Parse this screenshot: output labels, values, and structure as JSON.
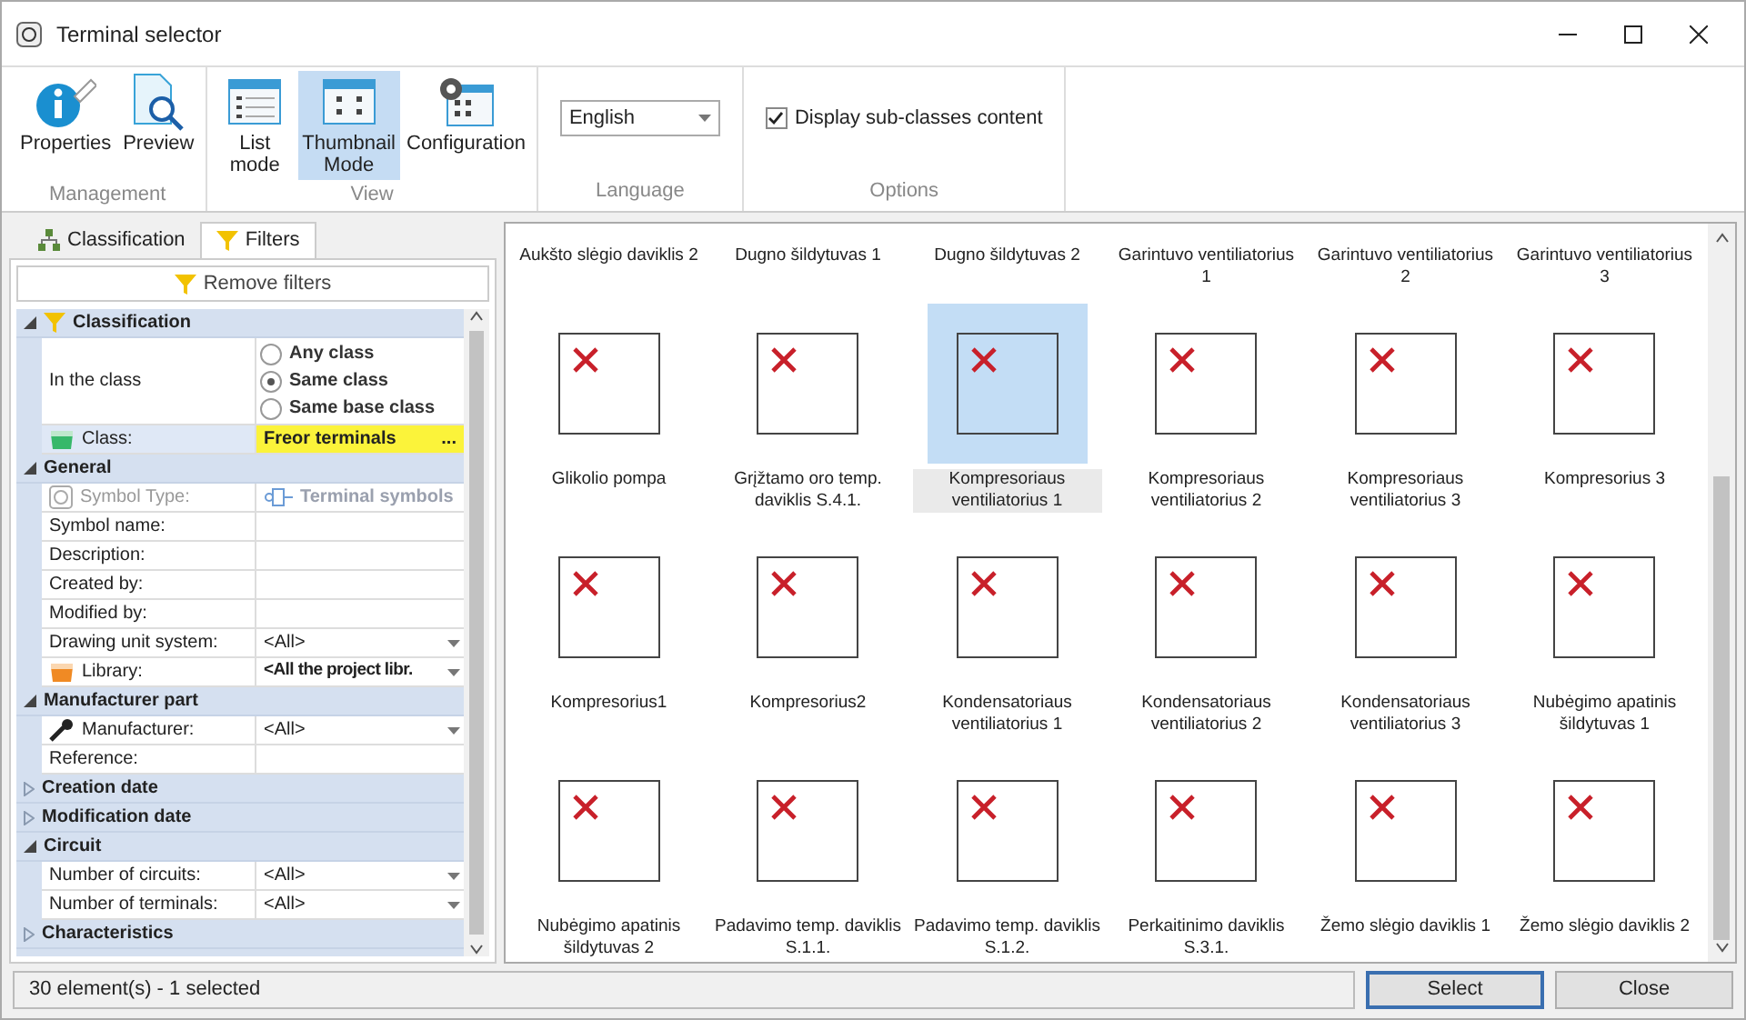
{
  "window": {
    "title": "Terminal selector"
  },
  "ribbon": {
    "groups": [
      {
        "label": "Management",
        "buttons": [
          {
            "kind": "properties",
            "label": "Properties",
            "selected": false
          },
          {
            "kind": "preview",
            "label": "Preview",
            "selected": false
          }
        ]
      },
      {
        "label": "View",
        "buttons": [
          {
            "kind": "list",
            "label": "List mode",
            "selected": false
          },
          {
            "kind": "thumbnail",
            "label": "Thumbnail Mode",
            "selected": true
          },
          {
            "kind": "configuration",
            "label": "Configuration",
            "selected": false
          }
        ]
      },
      {
        "label": "Language",
        "kind": "dropdown",
        "value": "English"
      },
      {
        "label": "Options",
        "kind": "checkbox",
        "text": "Display sub-classes content",
        "checked": true
      }
    ]
  },
  "left_tabs": [
    {
      "kind": "tree",
      "label": "Classification",
      "selected": false
    },
    {
      "kind": "filter",
      "label": "Filters",
      "selected": true
    }
  ],
  "remove_filters": "Remove filters",
  "property_grid": [
    {
      "category": "Classification",
      "expanded": true,
      "rows": [
        {
          "kind": "radio",
          "label": "In the class",
          "options": [
            {
              "label": "Any class",
              "selected": false
            },
            {
              "label": "Same class",
              "selected": true
            },
            {
              "label": "Same base class",
              "selected": false
            }
          ]
        },
        {
          "kind": "highlight",
          "label": "Class:",
          "value": "Freor terminals",
          "button": "..."
        }
      ]
    },
    {
      "category": "General",
      "expanded": true,
      "rows": [
        {
          "kind": "disabled",
          "label": "Symbol Type:",
          "value": "Terminal symbols"
        },
        {
          "kind": "text",
          "label": "Symbol name:"
        },
        {
          "kind": "text",
          "label": "Description:"
        },
        {
          "kind": "text",
          "label": "Created by:"
        },
        {
          "kind": "text",
          "label": "Modified by:"
        },
        {
          "kind": "dropdown",
          "label": "Drawing unit system:",
          "value": "<All>"
        },
        {
          "kind": "dropdown",
          "label": "Library:",
          "value": "<All the project libr.",
          "bold": true
        }
      ]
    },
    {
      "category": "Manufacturer part",
      "expanded": true,
      "rows": [
        {
          "kind": "dropdown",
          "label": "Manufacturer:",
          "value": "<All>"
        },
        {
          "kind": "text",
          "label": "Reference:"
        }
      ]
    },
    {
      "category": "Creation date",
      "expanded": false
    },
    {
      "category": "Modification date",
      "expanded": false
    },
    {
      "category": "Circuit",
      "expanded": true,
      "rows": [
        {
          "kind": "dropdown",
          "label": "Number of circuits:",
          "value": "<All>"
        },
        {
          "kind": "dropdown",
          "label": "Number of terminals:",
          "value": "<All>"
        }
      ]
    },
    {
      "category": "Characteristics",
      "expanded": false
    }
  ],
  "thumbnails": {
    "top_labels": [
      "Aukšto slėgio daviklis 2",
      "Dugno šildytuvas 1",
      "Dugno šildytuvas 2",
      "Garintuvo ventiliatorius 1",
      "Garintuvo ventiliatorius 2",
      "Garintuvo ventiliatorius 3"
    ],
    "items": [
      {
        "label": "Glikolio pompa",
        "selected": false
      },
      {
        "label": "Grįžtamo oro temp. daviklis S.4.1.",
        "selected": false
      },
      {
        "label": "Kompresoriaus ventiliatorius 1",
        "selected": true
      },
      {
        "label": "Kompresoriaus ventiliatorius 2",
        "selected": false
      },
      {
        "label": "Kompresoriaus ventiliatorius 3",
        "selected": false
      },
      {
        "label": "Kompresorius 3",
        "selected": false
      },
      {
        "label": "Kompresorius1",
        "selected": false
      },
      {
        "label": "Kompresorius2",
        "selected": false
      },
      {
        "label": "Kondensatoriaus ventiliatorius 1",
        "selected": false
      },
      {
        "label": "Kondensatoriaus ventiliatorius 2",
        "selected": false
      },
      {
        "label": "Kondensatoriaus ventiliatorius 3",
        "selected": false
      },
      {
        "label": "Nubėgimo apatinis šildytuvas 1",
        "selected": false
      },
      {
        "label": "Nubėgimo apatinis šildytuvas 2",
        "selected": false
      },
      {
        "label": "Padavimo temp. daviklis S.1.1.",
        "selected": false
      },
      {
        "label": "Padavimo temp. daviklis S.1.2.",
        "selected": false
      },
      {
        "label": "Perkaitinimo daviklis S.3.1.",
        "selected": false
      },
      {
        "label": "Žemo slėgio daviklis 1",
        "selected": false
      },
      {
        "label": "Žemo slėgio daviklis 2",
        "selected": false
      }
    ]
  },
  "status": "30 element(s) - 1 selected",
  "buttons": [
    {
      "label": "Select",
      "default": true
    },
    {
      "label": "Close",
      "default": false
    }
  ]
}
